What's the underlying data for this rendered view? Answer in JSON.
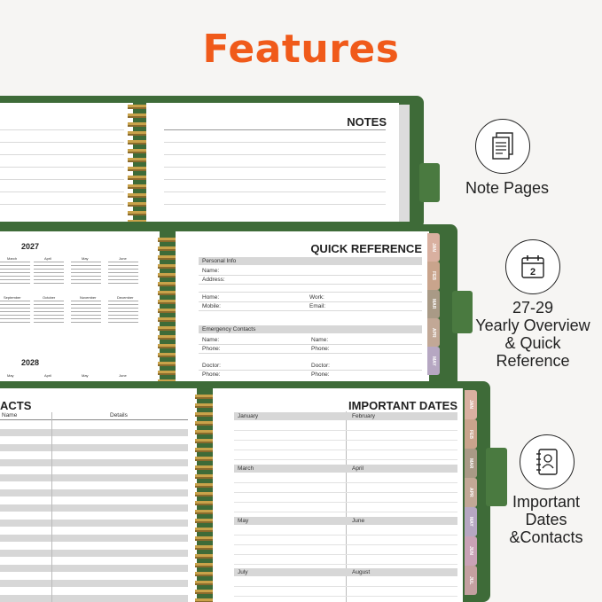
{
  "header": {
    "title": "Features"
  },
  "features": [
    {
      "icon": "note-pages-icon",
      "label_lines": [
        "Note Pages"
      ]
    },
    {
      "icon": "calendar-icon",
      "label_lines": [
        "27-29",
        "Yearly Overview",
        "& Quick",
        "Reference"
      ]
    },
    {
      "icon": "contacts-book-icon",
      "label_lines": [
        "Important",
        "Dates",
        "&Contacts"
      ]
    }
  ],
  "planner_notes": {
    "heading": "NOTES"
  },
  "planner_reference": {
    "heading": "QUICK REFERENCE",
    "year_top": "2027",
    "year_bottom": "2028",
    "months_row1": [
      "March",
      "April",
      "May",
      "June"
    ],
    "months_row2": [
      "September",
      "October",
      "November",
      "December"
    ],
    "months_row3": [
      "May",
      "April",
      "May",
      "June"
    ],
    "personal_info": "Personal Info",
    "name": "Name:",
    "address": "Address:",
    "home": "Home:",
    "work": "Work:",
    "mobile": "Mobile:",
    "email": "Email:",
    "emergency": "Emergency Contacts",
    "e_name_1": "Name:",
    "e_name_2": "Name:",
    "e_phone_1": "Phone:",
    "e_phone_2": "Phone:",
    "doctor_1": "Doctor:",
    "doctor_2": "Doctor:",
    "d_phone_1": "Phone:",
    "d_phone_2": "Phone:",
    "tabs": [
      "JAN",
      "FEB",
      "MAR",
      "APR",
      "MAY"
    ]
  },
  "planner_dates": {
    "heading_left": "ACTS",
    "col_name": "Name",
    "col_details": "Details",
    "heading_right": "IMPORTANT DATES",
    "months": [
      "January",
      "February",
      "March",
      "April",
      "May",
      "June",
      "July",
      "August"
    ],
    "tabs": [
      "JAN",
      "FEB",
      "MAR",
      "APR",
      "MAY",
      "JUN",
      "JUL"
    ]
  },
  "colors": {
    "title": "#f05a1a",
    "cover": "#3e6b38",
    "tab_colors": [
      "#d9b0a0",
      "#c9a48c",
      "#a99a86",
      "#c2a896",
      "#b6a7c2",
      "#c9a2b6",
      "#c4a0a0"
    ]
  }
}
